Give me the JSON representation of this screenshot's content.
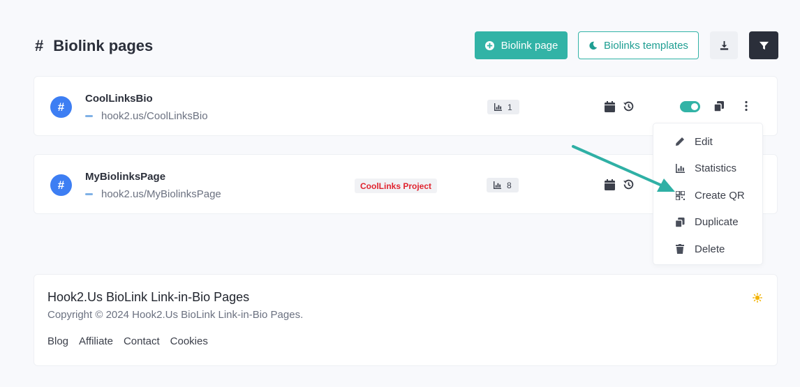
{
  "header": {
    "title": "Biolink pages",
    "title_icon": "hash-icon",
    "primary_button_label": "Biolink page",
    "templates_button_label": "Biolinks templates"
  },
  "links": [
    {
      "name": "CoolLinksBio",
      "url": "hook2.us/CoolLinksBio",
      "project": "",
      "stat_count": "1",
      "enabled": true
    },
    {
      "name": "MyBiolinksPage",
      "url": "hook2.us/MyBiolinksPage",
      "project": "CoolLinks Project",
      "stat_count": "8",
      "enabled": true
    }
  ],
  "dropdown": {
    "items": [
      {
        "label": "Edit",
        "icon": "pencil-icon"
      },
      {
        "label": "Statistics",
        "icon": "chart-icon"
      },
      {
        "label": "Create QR",
        "icon": "qr-code-icon"
      },
      {
        "label": "Duplicate",
        "icon": "duplicate-icon"
      },
      {
        "label": "Delete",
        "icon": "trash-icon"
      }
    ]
  },
  "footer": {
    "title": "Hook2.Us BioLink Link-in-Bio Pages",
    "copyright": "Copyright © 2024 Hook2.Us BioLink Link-in-Bio Pages.",
    "links": [
      "Blog",
      "Affiliate",
      "Contact",
      "Cookies"
    ]
  },
  "colors": {
    "accent": "#32b3a6",
    "avatar": "#3d7ef3",
    "project_badge_text": "#e0242f",
    "dark_button": "#2b2f3a",
    "annotation_arrow": "#2fb0a5",
    "theme_icon": "#f2b305"
  }
}
